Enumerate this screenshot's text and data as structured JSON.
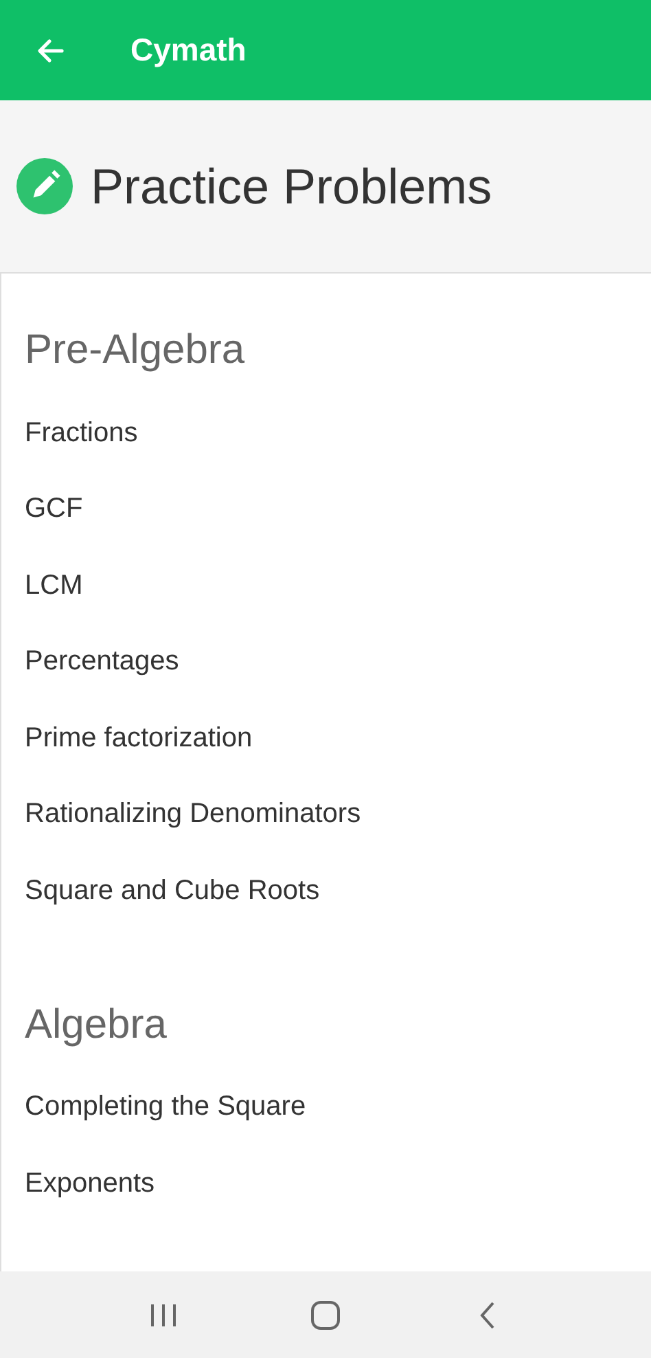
{
  "app_bar": {
    "title": "Cymath"
  },
  "page_title": "Practice Problems",
  "sections": [
    {
      "heading": "Pre-Algebra",
      "items": [
        "Fractions",
        "GCF",
        "LCM",
        "Percentages",
        "Prime factorization",
        "Rationalizing Denominators",
        "Square and Cube Roots"
      ]
    },
    {
      "heading": "Algebra",
      "items": [
        "Completing the Square",
        "Exponents"
      ]
    }
  ]
}
